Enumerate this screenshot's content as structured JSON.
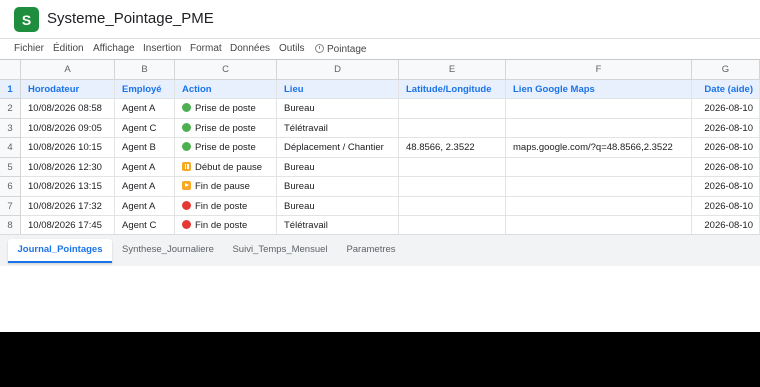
{
  "app": {
    "logo_letter": "S",
    "title": "Systeme_Pointage_PME",
    "accent_color": "#1a73e8",
    "brand_color": "#1e8e3e"
  },
  "menu": [
    {
      "label": "Fichier"
    },
    {
      "label": "Édition"
    },
    {
      "label": "Affichage"
    },
    {
      "label": "Insertion"
    },
    {
      "label": "Format"
    },
    {
      "label": "Données"
    },
    {
      "label": "Outils"
    },
    {
      "label": "Pointage",
      "icon": "timer-icon"
    }
  ],
  "grid": {
    "columns": [
      "A",
      "B",
      "C",
      "D",
      "E",
      "F",
      "G"
    ],
    "row_numbers": [
      "1",
      "2",
      "3",
      "4",
      "5",
      "6",
      "7",
      "8"
    ],
    "headers": [
      "Horodateur",
      "Employé",
      "Action",
      "Lieu",
      "Latitude/Longitude",
      "Lien Google Maps",
      "Date (aide)"
    ],
    "rows": [
      {
        "timestamp": "10/08/2026 08:58",
        "employee": "Agent A",
        "action": "Prise de poste",
        "action_icon": "green-circle-icon",
        "place": "Bureau",
        "latlng": "",
        "maps": "",
        "date": "2026-08-10"
      },
      {
        "timestamp": "10/08/2026 09:05",
        "employee": "Agent C",
        "action": "Prise de poste",
        "action_icon": "green-circle-icon",
        "place": "Télétravail",
        "latlng": "",
        "maps": "",
        "date": "2026-08-10"
      },
      {
        "timestamp": "10/08/2026 10:15",
        "employee": "Agent B",
        "action": "Prise de poste",
        "action_icon": "green-circle-icon",
        "place": "Déplacement / Chantier",
        "latlng": "48.8566, 2.3522",
        "maps": "maps.google.com/?q=48.8566,2.3522",
        "date": "2026-08-10"
      },
      {
        "timestamp": "10/08/2026 12:30",
        "employee": "Agent A",
        "action": "Début de pause",
        "action_icon": "pause-icon",
        "place": "Bureau",
        "latlng": "",
        "maps": "",
        "date": "2026-08-10"
      },
      {
        "timestamp": "10/08/2026 13:15",
        "employee": "Agent A",
        "action": "Fin de pause",
        "action_icon": "play-icon",
        "place": "Bureau",
        "latlng": "",
        "maps": "",
        "date": "2026-08-10"
      },
      {
        "timestamp": "10/08/2026 17:32",
        "employee": "Agent A",
        "action": "Fin de poste",
        "action_icon": "red-circle-icon",
        "place": "Bureau",
        "latlng": "",
        "maps": "",
        "date": "2026-08-10"
      },
      {
        "timestamp": "10/08/2026 17:45",
        "employee": "Agent C",
        "action": "Fin de poste",
        "action_icon": "red-circle-icon",
        "place": "Télétravail",
        "latlng": "",
        "maps": "",
        "date": "2026-08-10"
      }
    ]
  },
  "tabs": [
    {
      "label": "Journal_Pointages",
      "active": true
    },
    {
      "label": "Synthese_Journaliere",
      "active": false
    },
    {
      "label": "Suivi_Temps_Mensuel",
      "active": false
    },
    {
      "label": "Parametres",
      "active": false
    }
  ]
}
